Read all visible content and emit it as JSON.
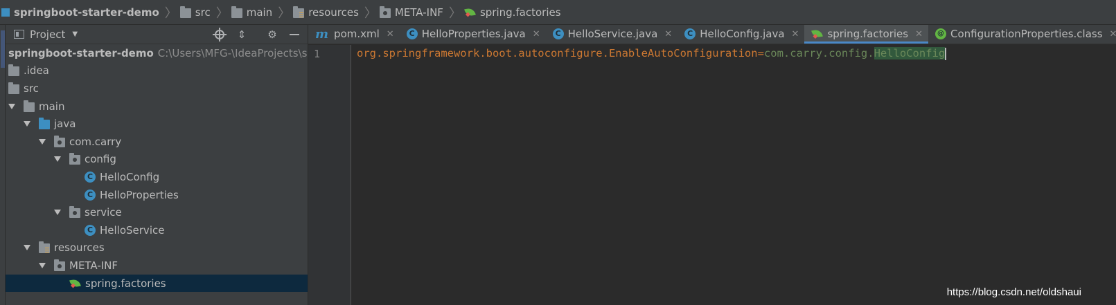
{
  "breadcrumb": [
    {
      "label": "springboot-starter-demo",
      "icon": "project-icon"
    },
    {
      "label": "src",
      "icon": "folder-icon"
    },
    {
      "label": "main",
      "icon": "folder-icon"
    },
    {
      "label": "resources",
      "icon": "resources-folder-icon"
    },
    {
      "label": "META-INF",
      "icon": "package-folder-icon"
    },
    {
      "label": "spring.factories",
      "icon": "spring-icon"
    }
  ],
  "panel": {
    "title": "Project",
    "toolbar_icons": [
      "locate-icon",
      "collapse-all-icon",
      "gear-icon",
      "minimize-icon"
    ]
  },
  "tree": [
    {
      "label": "springboot-starter-demo",
      "path": "C:\\Users\\MFG-\\IdeaProjects\\springboot-starter-demo",
      "depth": 0,
      "expanded": true,
      "icon": "project-icon"
    },
    {
      "label": ".idea",
      "depth": 1,
      "expanded": false,
      "icon": "folder-icon"
    },
    {
      "label": "src",
      "depth": 1,
      "expanded": false,
      "icon": "folder-icon"
    },
    {
      "label": "main",
      "depth": 1,
      "expanded": true,
      "icon": "folder-icon"
    },
    {
      "label": "java",
      "depth": 2,
      "expanded": true,
      "icon": "source-folder-icon"
    },
    {
      "label": "com.carry",
      "depth": 3,
      "expanded": true,
      "icon": "package-icon"
    },
    {
      "label": "config",
      "depth": 4,
      "expanded": true,
      "icon": "package-icon"
    },
    {
      "label": "HelloConfig",
      "depth": 5,
      "icon": "class-icon"
    },
    {
      "label": "HelloProperties",
      "depth": 5,
      "icon": "class-icon"
    },
    {
      "label": "service",
      "depth": 4,
      "expanded": true,
      "icon": "package-icon"
    },
    {
      "label": "HelloService",
      "depth": 5,
      "icon": "class-icon"
    },
    {
      "label": "resources",
      "depth": 2,
      "expanded": true,
      "icon": "resources-folder-icon"
    },
    {
      "label": "META-INF",
      "depth": 3,
      "expanded": true,
      "icon": "package-folder-icon"
    },
    {
      "label": "spring.factories",
      "depth": 4,
      "icon": "spring-icon",
      "selected": true
    }
  ],
  "tabs": [
    {
      "label": "pom.xml",
      "icon": "maven-icon",
      "active": false
    },
    {
      "label": "HelloProperties.java",
      "icon": "class-icon",
      "active": false
    },
    {
      "label": "HelloService.java",
      "icon": "class-icon",
      "active": false
    },
    {
      "label": "HelloConfig.java",
      "icon": "class-icon",
      "active": false
    },
    {
      "label": "spring.factories",
      "icon": "spring-icon",
      "active": true
    },
    {
      "label": "ConfigurationProperties.class",
      "icon": "annotation-icon",
      "active": false
    }
  ],
  "editor": {
    "line_number": "1",
    "key": "org.springframework.boot.autoconfigure.EnableAutoConfiguration",
    "equals": "=",
    "value_prefix": "com.carry.config.",
    "value_class": "HelloConfig"
  },
  "watermark": "https://blog.csdn.net/oldshaui",
  "colors": {
    "background": "#2b2b2b",
    "panel": "#3c3f41",
    "selection": "#0d293e",
    "key": "#cc7832",
    "value": "#6a8759",
    "accent": "#4a88c7"
  }
}
